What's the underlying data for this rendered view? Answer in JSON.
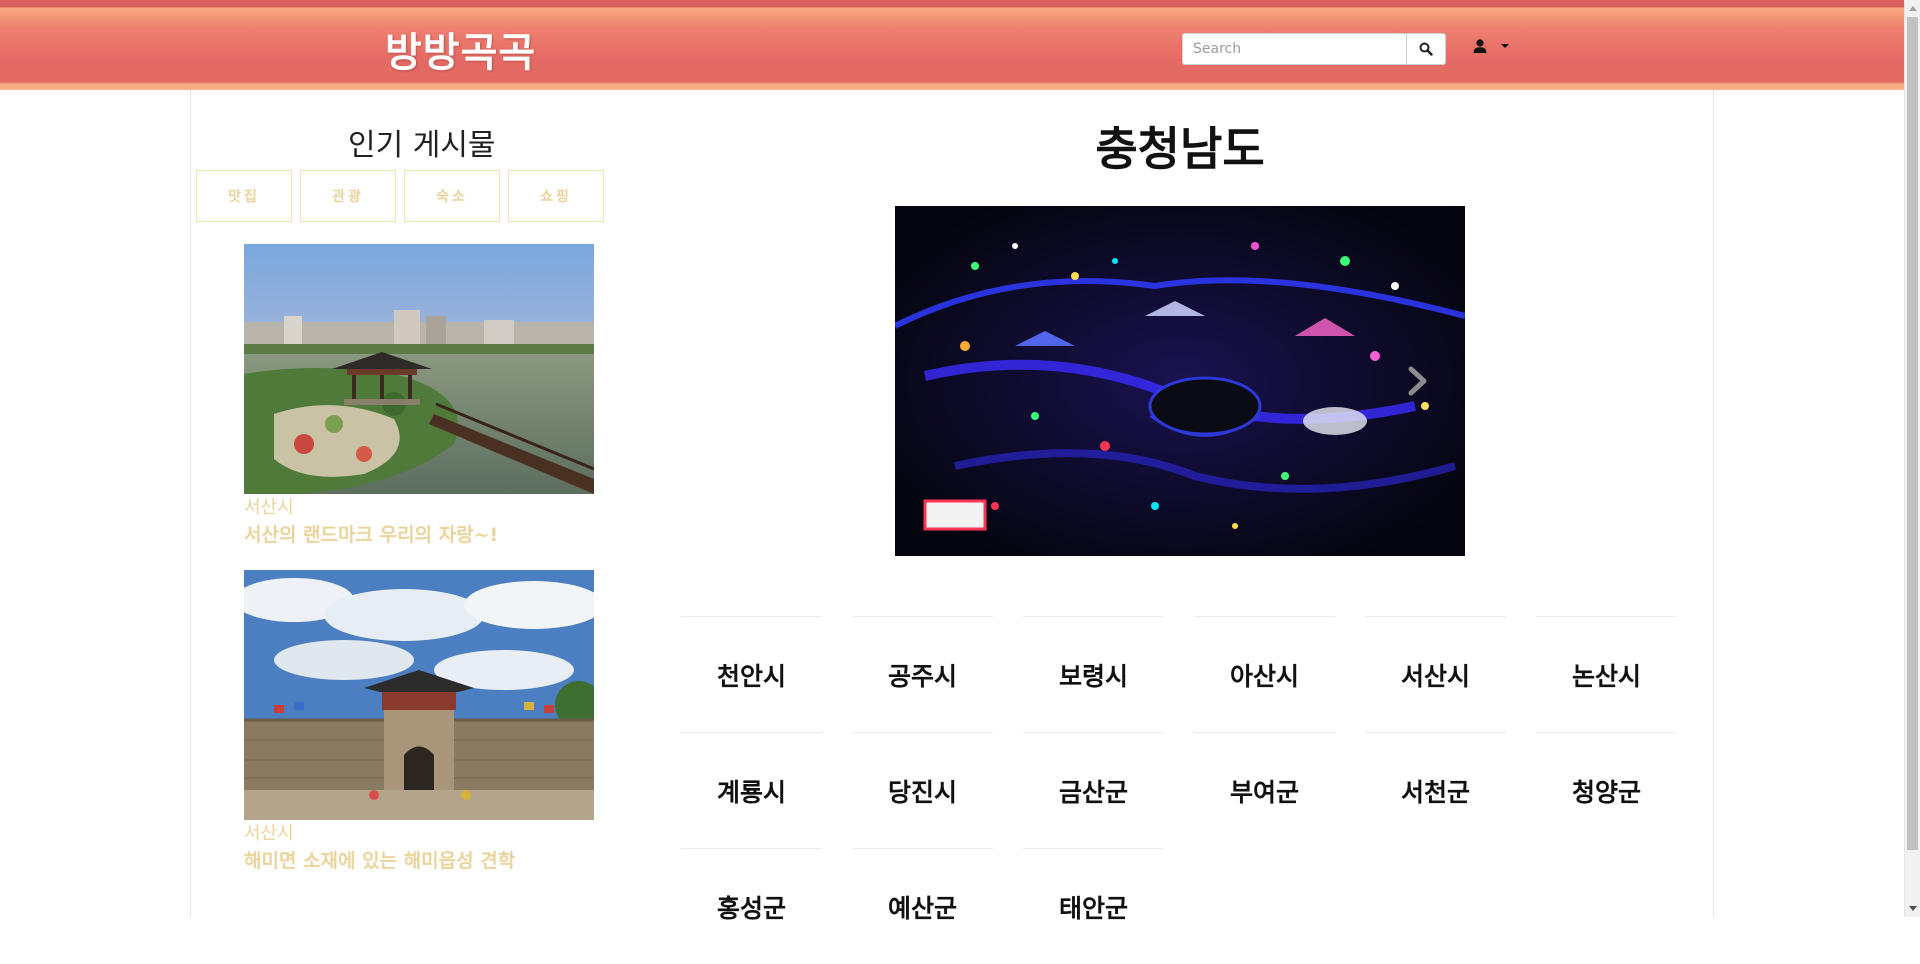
{
  "header": {
    "logo": "방방곡곡",
    "search_placeholder": "Search"
  },
  "sidebar": {
    "title": "인기 게시물",
    "tabs": [
      "맛집",
      "관광",
      "숙소",
      "쇼핑"
    ],
    "posts": [
      {
        "region": "서산시",
        "title": "서산의 랜드마크 우리의 자랑~!"
      },
      {
        "region": "서산시",
        "title": "해미면 소재에 있는 해미읍성 견학"
      }
    ]
  },
  "main": {
    "title": "충청남도",
    "cities": [
      "천안시",
      "공주시",
      "보령시",
      "아산시",
      "서산시",
      "논산시",
      "계룡시",
      "당진시",
      "금산군",
      "부여군",
      "서천군",
      "청양군",
      "홍성군",
      "예산군",
      "태안군"
    ]
  },
  "colors": {
    "header_red": "#e36964",
    "header_peach": "#f6a982",
    "accent_gold": "#ebd49c"
  }
}
